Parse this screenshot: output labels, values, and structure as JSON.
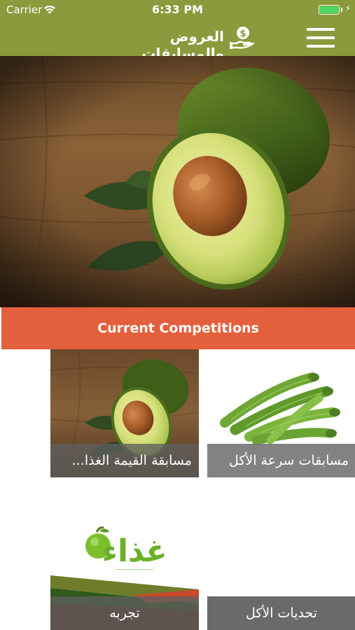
{
  "status_bar": {
    "carrier": "Carrier",
    "time": "6:33 PM"
  },
  "nav": {
    "title": "العروض والمسابقات",
    "icon": "money-hand-icon",
    "menu_icon": "hamburger-menu-icon"
  },
  "hero": {
    "image": "avocado-photo"
  },
  "section": {
    "title": "Current Competitions"
  },
  "tiles": [
    {
      "caption": "مسابقة القيمة الغذا...",
      "image": "avocado-photo"
    },
    {
      "caption": "مسابقات سرعة الأكل",
      "image": "okra-photo"
    },
    {
      "caption": "تجربه",
      "image": "ghitha-logo",
      "logo_text": "غذاء"
    },
    {
      "caption": "تحديات الأكل",
      "image": "none"
    }
  ],
  "colors": {
    "header": "#8a9a3c",
    "section": "#e45f3c",
    "caption_bg": "#5f5f5f"
  }
}
